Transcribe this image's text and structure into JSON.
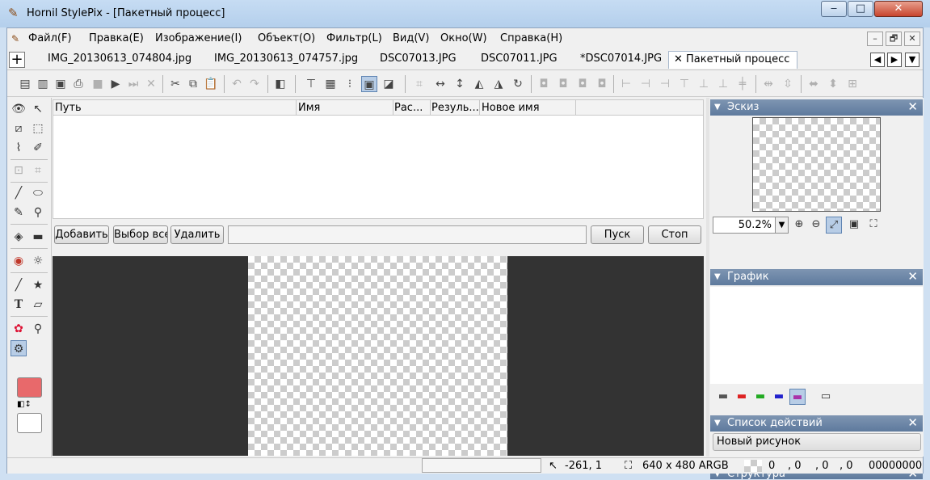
{
  "window": {
    "title": "Hornil StylePix - [Пакетный процесс]",
    "controls": {
      "minimize": "‒",
      "maximize": "□",
      "close": "✕"
    }
  },
  "menu": {
    "items": [
      "Файл(F)",
      "Правка(E)",
      "Изображение(I)",
      "Объект(O)",
      "Фильтр(L)",
      "Вид(V)",
      "Окно(W)",
      "Справка(H)"
    ],
    "mdi": {
      "minimize": "–",
      "restore": "🗗",
      "close": "✕"
    }
  },
  "tabs": {
    "new_tab": "+",
    "items": [
      "IMG_20130613_074804.jpg",
      "IMG_20130613_074757.jpg",
      "DSC07013.JPG",
      "DSC07011.JPG",
      "*DSC07014.JPG"
    ],
    "active": "✕ Пакетный процесс",
    "nav": {
      "prev": "◀",
      "next": "▶",
      "menu": "▼"
    }
  },
  "toolbar": {
    "icons": [
      "new-icon",
      "open-icon",
      "save-icon",
      "print-icon",
      "play-icon",
      "step-icon",
      "stop-icon",
      "cut-icon",
      "copy-icon",
      "paste-icon",
      "undo-icon",
      "redo-icon",
      "panel-icon",
      "ruler-icon",
      "grid-icon",
      "snap-icon",
      "frame-icon",
      "fit-icon",
      "crop-icon",
      "flip-h-icon",
      "flip-v-icon",
      "rotate-left-icon",
      "rotate-right-icon",
      "rotate-free-icon",
      "align-icon"
    ]
  },
  "batch": {
    "columns": [
      "Путь",
      "Имя",
      "Рас...",
      "Резуль...",
      "Новое имя"
    ],
    "buttons": {
      "add": "Добавить",
      "select_all": "Выбор все",
      "delete": "Удалить",
      "start": "Пуск",
      "stop": "Стоп"
    }
  },
  "panels": {
    "thumbnail": {
      "title": "Эскиз",
      "zoom": "50.2%"
    },
    "graph": {
      "title": "График"
    },
    "actions": {
      "title": "Список действий",
      "items": [
        "Новый рисунок"
      ]
    },
    "structure": {
      "title": "Структура"
    }
  },
  "status": {
    "coords": "-261, 1",
    "size": "640 x 480 ARGB",
    "rgba": [
      "0",
      ", 0",
      ", 0",
      ", 0"
    ],
    "hex": "00000000"
  },
  "colors": {
    "foreground": "#e8696b",
    "background": "#ffffff",
    "panel_header": "#6e88aa"
  }
}
